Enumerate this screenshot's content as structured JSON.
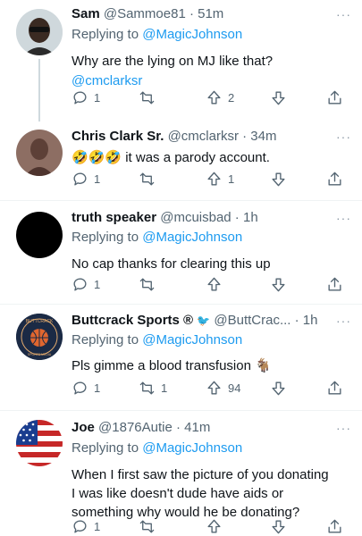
{
  "tweets": [
    {
      "name": "Sam",
      "handle": "@Sammoe81 · 51m",
      "replying_to_prefix": "Replying to ",
      "replying_to": "@MagicJohnson",
      "text": "Why are the lying on MJ like that?",
      "text2": "@cmclarksr",
      "replies": "1",
      "retweets": "",
      "likes": "2"
    },
    {
      "name": "Chris Clark Sr.",
      "handle": "@cmclarksr · 34m",
      "emoji": "🤣🤣🤣",
      "text": " it was a parody account.",
      "replies": "1",
      "retweets": "",
      "likes": "1"
    },
    {
      "name": "truth speaker",
      "handle": "@mcuisbad · 1h",
      "replying_to_prefix": "Replying to ",
      "replying_to": "@MagicJohnson",
      "text": "No cap thanks for clearing this up",
      "replies": "1",
      "retweets": "",
      "likes": ""
    },
    {
      "name": "Buttcrack Sports ®",
      "badge": "🐦",
      "handle": "@ButtCrac... · 1h",
      "replying_to_prefix": "Replying to ",
      "replying_to": "@MagicJohnson",
      "text": "Pls gimme a blood transfusion 🐐",
      "avatar_text_top": "BUTTCRACK",
      "avatar_text_bottom": "SPORTS MEDIA",
      "replies": "1",
      "retweets": "1",
      "likes": "94"
    },
    {
      "name": "Joe",
      "handle": "@1876Autie · 41m",
      "replying_to_prefix": "Replying to ",
      "replying_to": "@MagicJohnson",
      "lines": [
        "When I first saw the picture of you donating",
        "I was like doesn't dude have aids or",
        "something why would he be donating?"
      ],
      "replies": "1",
      "retweets": "",
      "likes": ""
    }
  ],
  "more_label": "···",
  "colors": {
    "link": "#1d9bf0",
    "muted": "#536471",
    "divider": "#eff3f4"
  }
}
